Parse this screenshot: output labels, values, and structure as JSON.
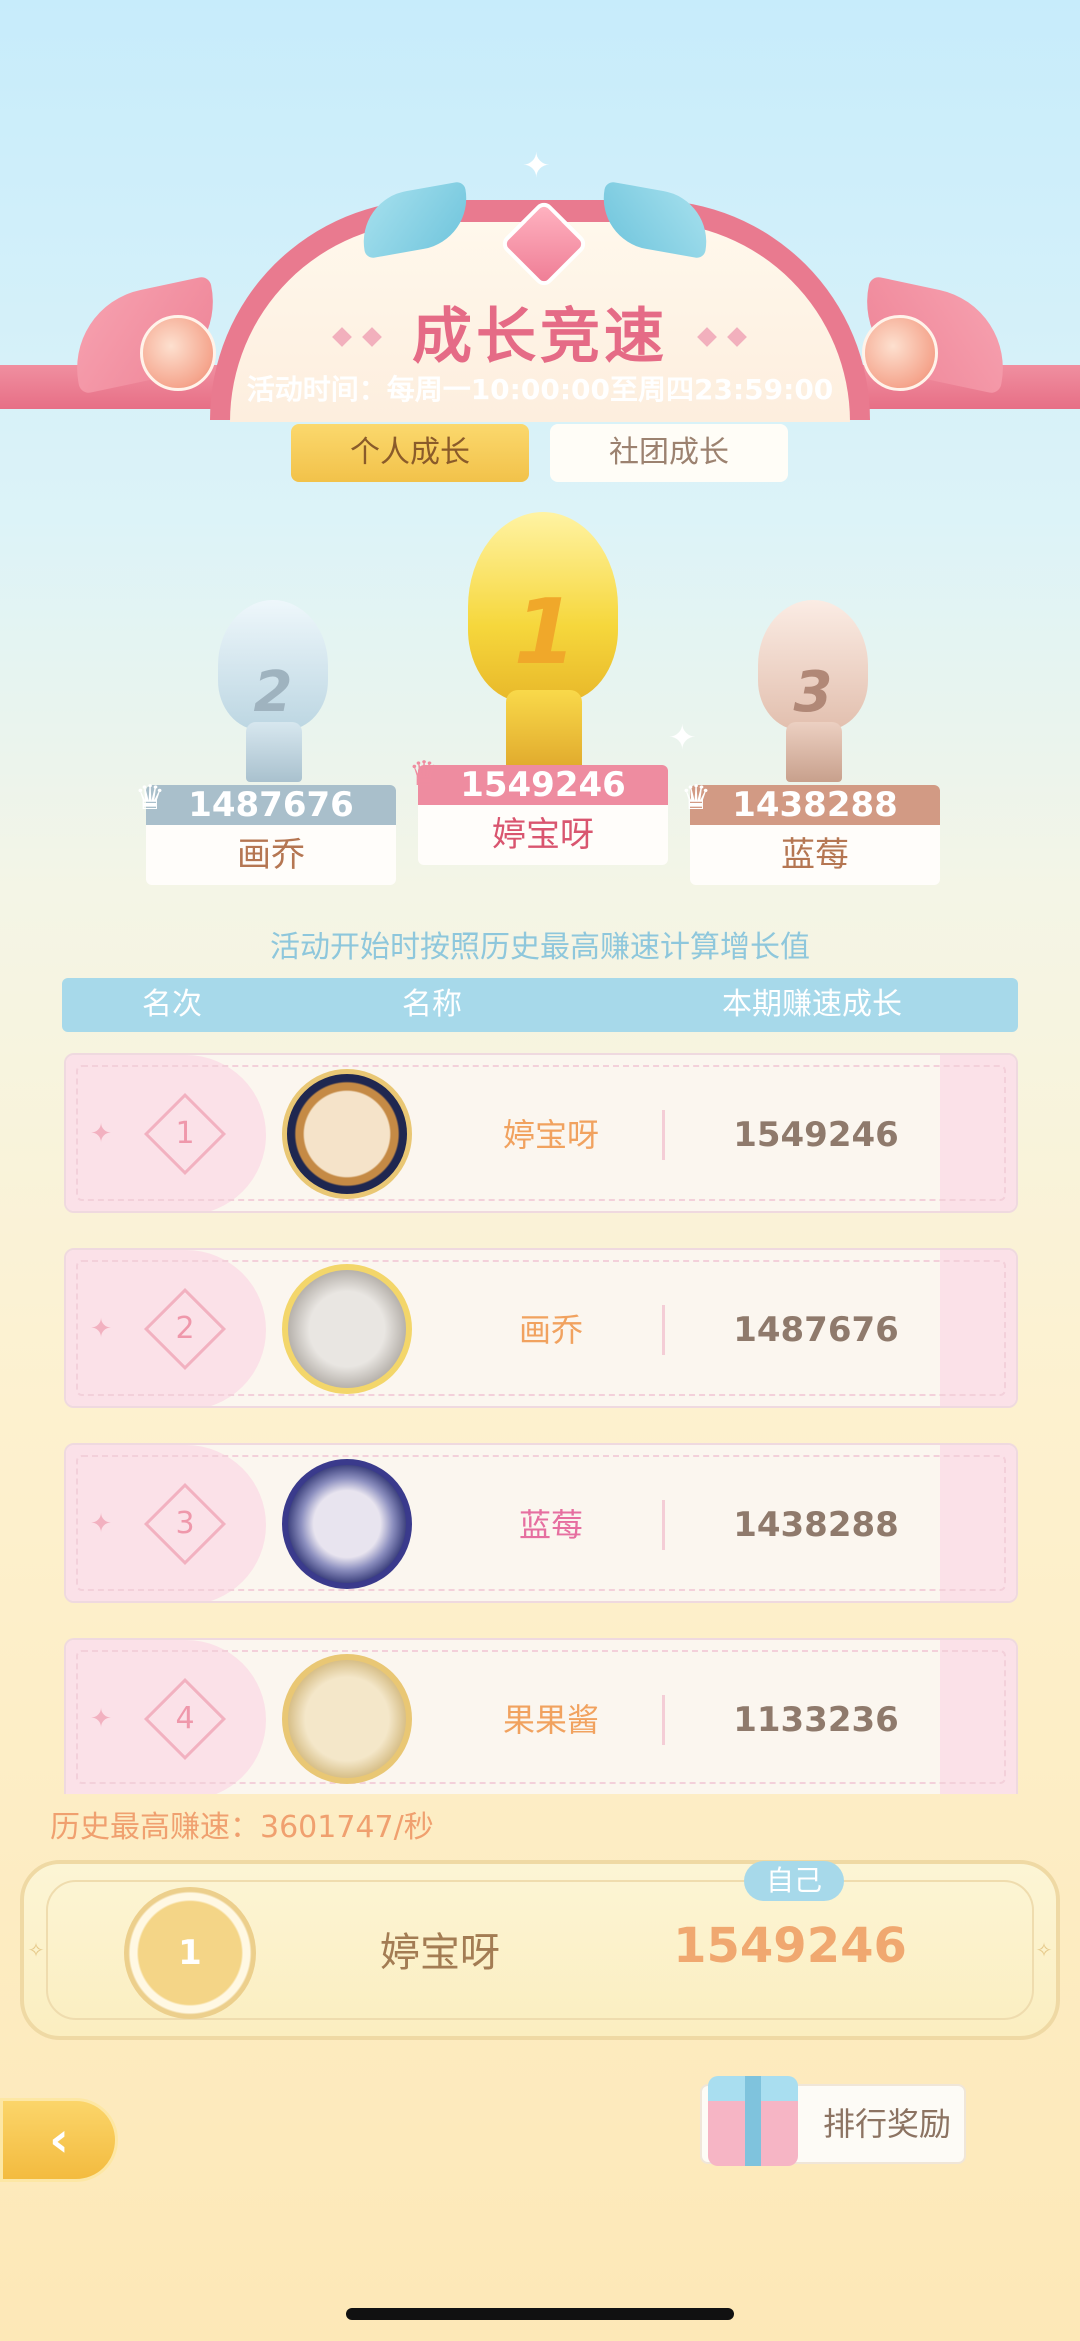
{
  "header": {
    "title": "成长竞速",
    "event_time": "活动时间：每周一10:00:00至周四23:59:00"
  },
  "tabs": [
    {
      "label": "个人成长",
      "active": true
    },
    {
      "label": "社团成长",
      "active": false
    }
  ],
  "podium": [
    {
      "rank": "1",
      "score": "1549246",
      "name": "婷宝呀"
    },
    {
      "rank": "2",
      "score": "1487676",
      "name": "画乔"
    },
    {
      "rank": "3",
      "score": "1438288",
      "name": "蓝莓"
    }
  ],
  "rule_note": "活动开始时按照历史最高赚速计算增长值",
  "table": {
    "headers": {
      "rank": "名次",
      "name": "名称",
      "growth": "本期赚速成长"
    },
    "rows": [
      {
        "rank": "1",
        "name": "婷宝呀",
        "value": "1549246",
        "name_color": "#f1a25f"
      },
      {
        "rank": "2",
        "name": "画乔",
        "value": "1487676",
        "name_color": "#f1a25f"
      },
      {
        "rank": "3",
        "name": "蓝莓",
        "value": "1438288",
        "name_color": "#e66fa0"
      },
      {
        "rank": "4",
        "name": "果果酱",
        "value": "1133236",
        "name_color": "#f1a25f"
      }
    ]
  },
  "history_best": "历史最高赚速：3601747/秒",
  "self": {
    "tag": "自己",
    "rank": "1",
    "name": "婷宝呀",
    "value": "1549246"
  },
  "buttons": {
    "rewards_label": "排行奖励",
    "back_icon": "back-arrow-icon"
  },
  "colors": {
    "accent_pink": "#e97a8f",
    "tab_active": "#f2c24a",
    "header_blue": "#a7d9ea",
    "value_orange": "#f0a870"
  }
}
